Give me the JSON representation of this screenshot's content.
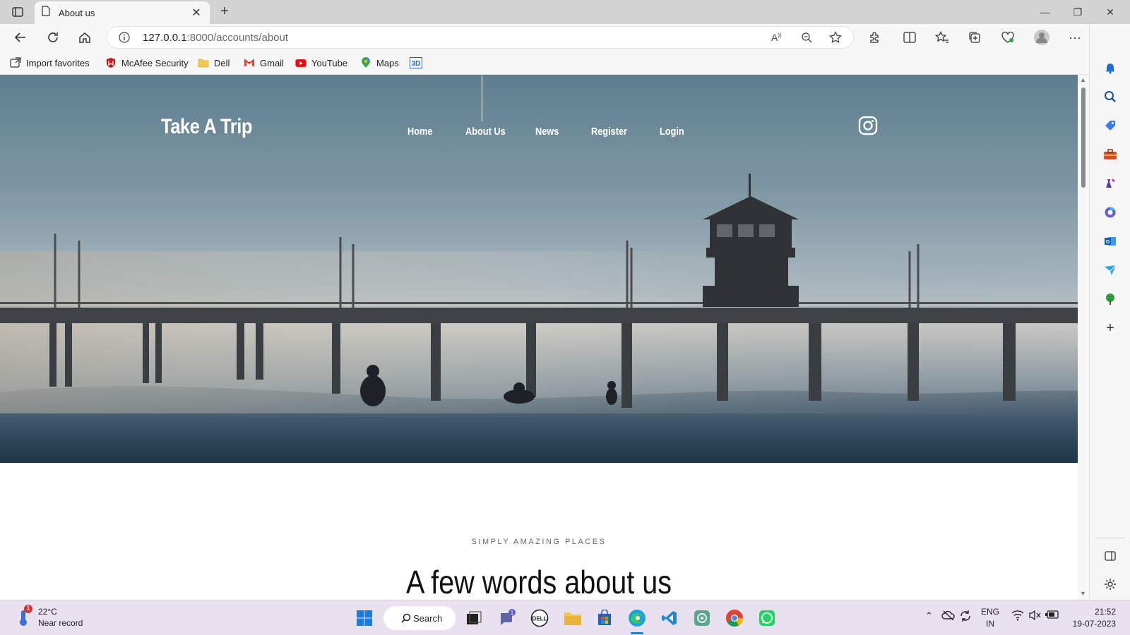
{
  "browser": {
    "tab_title": "About us",
    "url_host": "127.0.0.1",
    "url_path": ":8000/accounts/about",
    "favorites": [
      {
        "label": "Import favorites",
        "icon": "import-icon"
      },
      {
        "label": "McAfee Security",
        "icon": "mcafee-icon"
      },
      {
        "label": "Dell",
        "icon": "folder-icon"
      },
      {
        "label": "Gmail",
        "icon": "gmail-icon"
      },
      {
        "label": "YouTube",
        "icon": "youtube-icon"
      },
      {
        "label": "Maps",
        "icon": "maps-icon"
      },
      {
        "label": "",
        "icon": "3d-icon"
      }
    ]
  },
  "site": {
    "brand": "Take A Trip",
    "nav": [
      "Home",
      "About Us",
      "News",
      "Register",
      "Login"
    ],
    "section_subtitle": "SIMPLY AMAZING PLACES",
    "section_heading": "A few words about us"
  },
  "taskbar": {
    "weather_temp": "22°C",
    "weather_condition": "Near record",
    "weather_badge": "1",
    "search_label": "Search",
    "teams_badge": "1",
    "lang_top": "ENG",
    "lang_bottom": "IN",
    "time": "21:52",
    "date": "19-07-2023"
  },
  "colors": {
    "accent": "#0078d4",
    "taskbar_bg": "#e9e1f0",
    "chrome_bg": "#f7f7f7"
  }
}
